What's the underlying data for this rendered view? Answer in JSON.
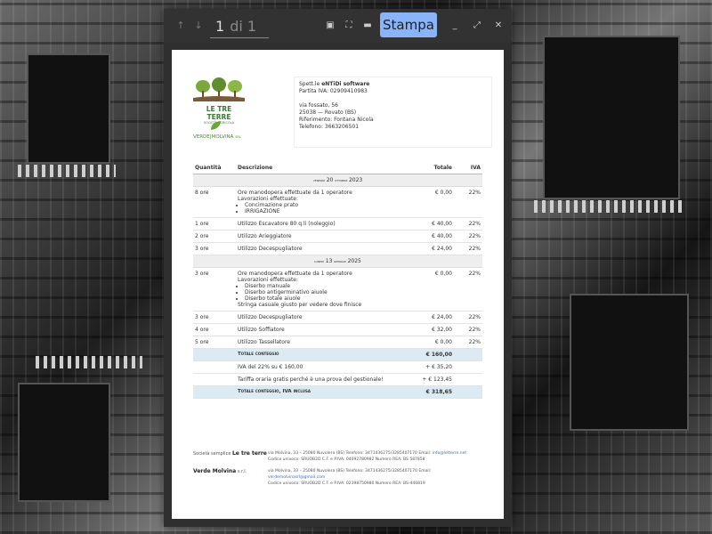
{
  "viewer": {
    "current_page": "1",
    "page_of": "di 1",
    "print_label": "Stampa"
  },
  "logos": {
    "company1_line1": "LE TRE TERRE",
    "company1_line2": "SOCIETÀ AGRICOLA",
    "company2_name": "VERDE",
    "company2_name2": "MOLVINA",
    "company2_suffix": "SRL"
  },
  "recipient": {
    "prefix": "Spett.le",
    "name": "eNTiDi software",
    "vat": "Partita IVA: 02909410983",
    "street": "via fossato, 56",
    "city": "25038 — Rovato (BS)",
    "reference": "Riferimento: Fontana Nicola",
    "phone": "Telefono: 3663206501"
  },
  "table": {
    "headers": {
      "qty": "Quantità",
      "desc": "Descrizione",
      "total": "Totale",
      "vat": "IVA"
    },
    "date1": {
      "dow": "venerdì",
      "day": "20",
      "month": "ottobre",
      "year": "2023"
    },
    "date2": {
      "dow": "lunedì",
      "day": "13",
      "month": "gennaio",
      "year": "2025"
    },
    "g1": [
      {
        "qty": "1 ore",
        "desc": "Utilizzo Escavatore 80 q.li (noleggio)",
        "total": "€ 40,00",
        "vat": "22%"
      },
      {
        "qty": "2 ore",
        "desc": "Utilizzo Arieggiatore",
        "total": "€ 40,00",
        "vat": "22%"
      },
      {
        "qty": "3 ore",
        "desc": "Utilizzo Decespugliatore",
        "total": "€ 24,00",
        "vat": "22%"
      }
    ],
    "row1": {
      "qty": "8 ore",
      "title": "Ore manodopera effettuate da 1 operatore",
      "sub": "Lavorazioni effettuate:",
      "items": [
        "Concimazione prato",
        "IRRIGAZIONE"
      ],
      "total": "€ 0,00",
      "vat": "22%"
    },
    "row2": {
      "qty": "3 ore",
      "title": "Ore manodopera effettuate da 1 operatore",
      "sub": "Lavorazioni effettuate:",
      "items": [
        "Diserbo manuale",
        "Diserbo antigerminativo aiuole",
        "Diserbo totale aiuole"
      ],
      "note": "Stringa casuale giusto per vedere dove finisce",
      "total": "€ 0,00",
      "vat": "22%"
    },
    "g2": [
      {
        "qty": "3 ore",
        "desc": "Utilizzo Decespugliatore",
        "total": "€ 24,00",
        "vat": "22%"
      },
      {
        "qty": "4 ore",
        "desc": "Utilizzo Soffiatore",
        "total": "€ 32,00",
        "vat": "22%"
      },
      {
        "qty": "5 ore",
        "desc": "Utilizzo Tassellatore",
        "total": "€ 0,00",
        "vat": "22%"
      }
    ],
    "subtotal_label": "Totale conteggio",
    "subtotal_value": "€ 160,00",
    "vat_line_label": "IVA del 22% su € 160,00",
    "vat_line_value": "+ € 35,20",
    "tariff_label": "Tariffa oraria gratis perché è una prova del gestionale!",
    "tariff_value": "+ € 123,45",
    "grand_label": "Totale conteggio, IVA inclusa",
    "grand_value": "€ 318,65"
  },
  "footer": {
    "c1_pre": "Società semplice",
    "c1_name": "Le tre terre",
    "c1_line1": "via Molvina, 33 – 25080 Nuvolera (BS)    Telefono: 3471436275/3285407170    Email: ",
    "c1_email": "info@letterre.net",
    "c1_line2": "Codice univoco: SRUOB2D    C.F. e P.IVA: 04092780982    Numero REA: BS 587858",
    "c2_name": "Verde Molvina",
    "c2_suffix": "s.r.l.",
    "c2_line1": "via Molvina, 33 – 25080 Nuvolera (BS)    Telefono: 3471436275/3285407170    Email:",
    "c2_email": "verdemolvinasrl@gmail.com",
    "c2_line2": "Codice univoco: SRUOB2D    C.F. e P.IVA: 02398750980    Numero REA: BS-446819"
  }
}
